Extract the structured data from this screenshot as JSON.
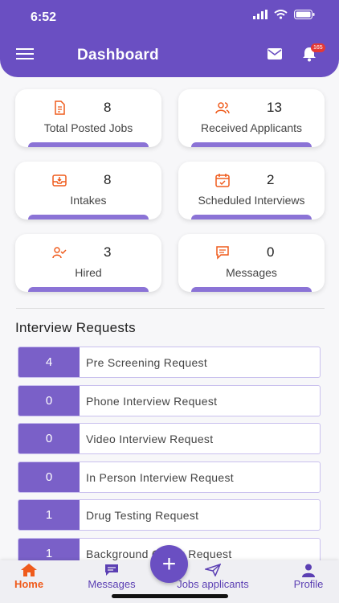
{
  "status_bar": {
    "time": "6:52"
  },
  "header": {
    "title": "Dashboard",
    "notification_count": "165"
  },
  "cards": [
    {
      "icon": "document-icon",
      "count": "8",
      "label": "Total Posted Jobs"
    },
    {
      "icon": "users-icon",
      "count": "13",
      "label": "Received Applicants"
    },
    {
      "icon": "inbox-icon",
      "count": "8",
      "label": "Intakes"
    },
    {
      "icon": "calendar-check-icon",
      "count": "2",
      "label": "Scheduled Interviews"
    },
    {
      "icon": "user-check-icon",
      "count": "3",
      "label": "Hired"
    },
    {
      "icon": "message-icon",
      "count": "0",
      "label": "Messages"
    }
  ],
  "interview_requests": {
    "title": "Interview Requests",
    "items": [
      {
        "count": "4",
        "label": "Pre Screening Request"
      },
      {
        "count": "0",
        "label": "Phone Interview Request"
      },
      {
        "count": "0",
        "label": "Video Interview Request"
      },
      {
        "count": "0",
        "label": "In Person Interview Request"
      },
      {
        "count": "1",
        "label": "Drug Testing Request"
      },
      {
        "count": "1",
        "label": "Background Check Request"
      }
    ]
  },
  "bottom_nav": {
    "home": "Home",
    "messages": "Messages",
    "jobs_applicants": "Jobs applicants",
    "profile": "Profile",
    "fab": "+"
  },
  "colors": {
    "primary": "#6a4fc2",
    "accent": "#ef5b1c",
    "badge": "#e53935"
  }
}
